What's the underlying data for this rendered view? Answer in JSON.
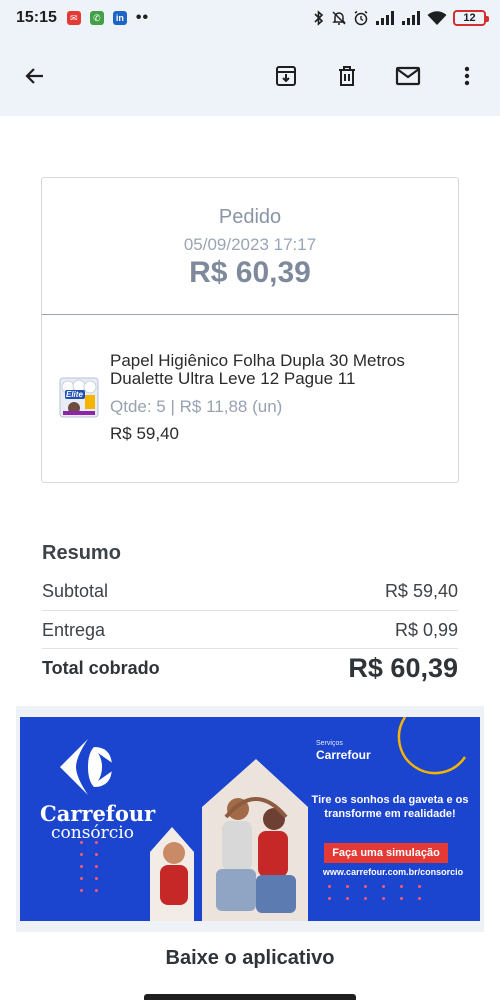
{
  "status_bar": {
    "time": "15:15",
    "battery_level": "12",
    "apps": [
      {
        "name": "messages-app-icon",
        "color": "#e53935",
        "glyph": "✉"
      },
      {
        "name": "phone-app-icon",
        "color": "#43a047",
        "glyph": "✆"
      },
      {
        "name": "linkedin-app-icon",
        "color": "#1e63c6",
        "glyph": "in"
      }
    ],
    "more": "••"
  },
  "toolbar": {
    "back": "back-arrow-icon",
    "archive": "archive-icon",
    "delete": "delete-icon",
    "mark_unread": "mail-icon",
    "more": "more-vert-icon"
  },
  "order": {
    "title": "Pedido",
    "date": "05/09/2023 17:17",
    "total": "R$ 60,39",
    "item": {
      "name": "Papel Higiênico Folha Dupla 30 Metros Dualette Ultra Leve 12 Pague 11",
      "qty_line": "Qtde: 5 | R$ 11,88 (un)",
      "price": "R$ 59,40",
      "thumb_brand": "Elite"
    }
  },
  "summary": {
    "title": "Resumo",
    "rows": [
      {
        "label": "Subtotal",
        "value": "R$ 59,40"
      },
      {
        "label": "Entrega",
        "value": "R$ 0,99"
      }
    ],
    "total_label": "Total cobrado",
    "total_value": "R$ 60,39"
  },
  "banner": {
    "brand": "Carrefour",
    "product": "consórcio",
    "services_small": "Serviços",
    "services_brand": "Carrefour",
    "headline": "Tire os sonhos da gaveta e os transforme em realidade!",
    "cta": "Faça uma simulação",
    "url": "www.carrefour.com.br/consorcio"
  },
  "footer": {
    "download_app": "Baixe o aplicativo"
  },
  "colors": {
    "banner_blue": "#1b44cf",
    "accent_red": "#e53935",
    "muted_text": "#8995a6"
  }
}
